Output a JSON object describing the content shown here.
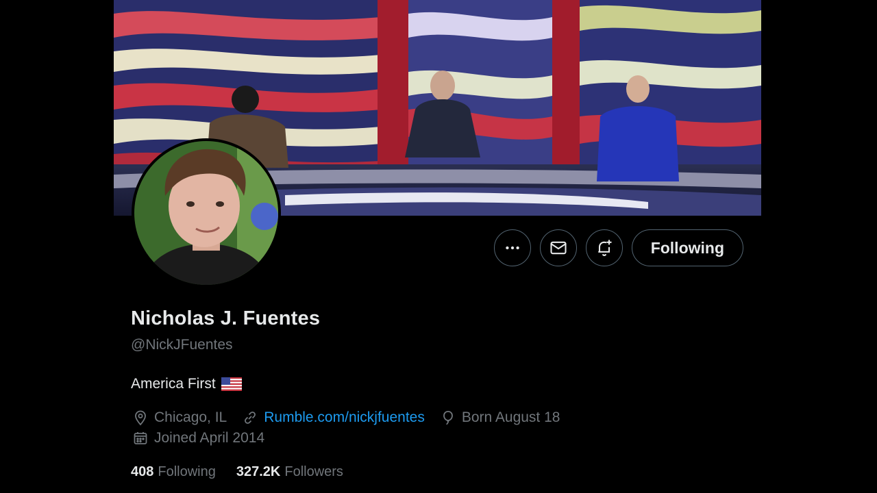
{
  "profile": {
    "display_name": "Nicholas J. Fuentes",
    "handle": "@NickJFuentes",
    "bio": "America First",
    "bio_emoji": "us-flag-emoji",
    "location": "Chicago, IL",
    "website": "Rumble.com/nickjfuentes",
    "birthday": "Born August 18",
    "joined": "Joined April 2014"
  },
  "actions": {
    "more_icon": "more-horizontal-icon",
    "message_icon": "envelope-icon",
    "notify_icon": "bell-plus-icon",
    "follow_label": "Following"
  },
  "stats": {
    "following_count": "408",
    "following_label": "Following",
    "followers_count": "327.2K",
    "followers_label": "Followers"
  },
  "colors": {
    "background": "#000000",
    "text_primary": "#e7e9ea",
    "text_secondary": "#71767b",
    "link": "#1d9bf0",
    "button_border": "#536471"
  }
}
